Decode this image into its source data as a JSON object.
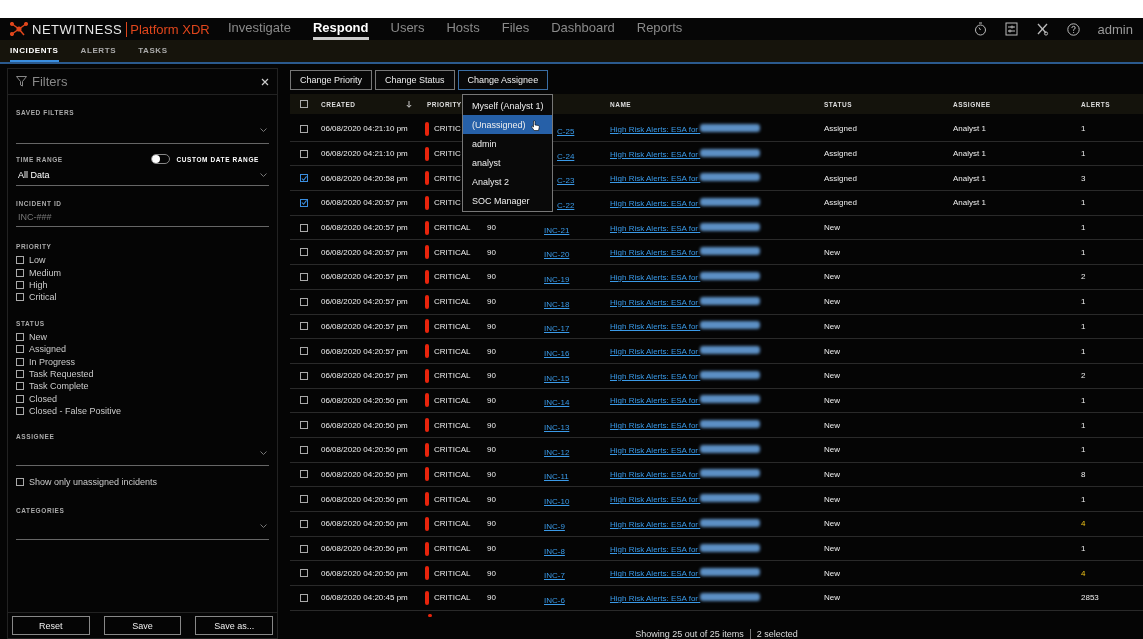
{
  "brand": {
    "name": "NETWITNESS",
    "product": "Platform XDR"
  },
  "nav": [
    {
      "label": "Investigate",
      "selected": false
    },
    {
      "label": "Respond",
      "selected": true
    },
    {
      "label": "Users",
      "selected": false
    },
    {
      "label": "Hosts",
      "selected": false
    },
    {
      "label": "Files",
      "selected": false
    },
    {
      "label": "Dashboard",
      "selected": false
    },
    {
      "label": "Reports",
      "selected": false
    }
  ],
  "user": "admin",
  "subtabs": [
    {
      "label": "INCIDENTS",
      "selected": true
    },
    {
      "label": "ALERTS",
      "selected": false
    },
    {
      "label": "TASKS",
      "selected": false
    }
  ],
  "filters": {
    "title": "Filters",
    "saved_filters_label": "SAVED FILTERS",
    "time_range_label": "TIME RANGE",
    "custom_range": {
      "label": "CUSTOM DATE RANGE",
      "on": false
    },
    "time_range_value": "All Data",
    "incident_id_label": "INCIDENT ID",
    "incident_id_placeholder": "INC-###",
    "priority_label": "PRIORITY",
    "priority": [
      {
        "label": "Low",
        "checked": false
      },
      {
        "label": "Medium",
        "checked": false
      },
      {
        "label": "High",
        "checked": false
      },
      {
        "label": "Critical",
        "checked": false
      }
    ],
    "status_label": "STATUS",
    "status": [
      {
        "label": "New",
        "checked": false
      },
      {
        "label": "Assigned",
        "checked": false
      },
      {
        "label": "In Progress",
        "checked": false
      },
      {
        "label": "Task Requested",
        "checked": false
      },
      {
        "label": "Task Complete",
        "checked": false
      },
      {
        "label": "Closed",
        "checked": false
      },
      {
        "label": "Closed - False Positive",
        "checked": false
      }
    ],
    "assignee_label": "ASSIGNEE",
    "unassigned_only": {
      "label": "Show only unassigned incidents",
      "checked": false
    },
    "categories_label": "CATEGORIES",
    "buttons": [
      "Reset",
      "Save",
      "Save as..."
    ]
  },
  "actions": [
    "Change Priority",
    "Change Status",
    "Change Assignee"
  ],
  "assignee_menu": [
    {
      "label": "Myself (Analyst 1)",
      "selected": false
    },
    {
      "label": "(Unassigned)",
      "selected": true
    },
    {
      "label": "admin",
      "selected": false
    },
    {
      "label": "analyst",
      "selected": false
    },
    {
      "label": "Analyst 2",
      "selected": false
    },
    {
      "label": "SOC Manager",
      "selected": false
    }
  ],
  "columns": {
    "created": "CREATED",
    "priority": "PRIORITY",
    "name": "NAME",
    "status": "STATUS",
    "assignee": "ASSIGNEE",
    "alerts": "ALERTS"
  },
  "header_checked": false,
  "rows": [
    {
      "checked": false,
      "created": "06/08/2020 04:21:10 pm",
      "priority": "CRITIC",
      "score": "",
      "id": "C-25",
      "name": "High Risk Alerts: ESA for",
      "status": "Assigned",
      "assignee": "Analyst 1",
      "alerts": "1",
      "flagged": false
    },
    {
      "checked": false,
      "created": "06/08/2020 04:21:10 pm",
      "priority": "CRITIC",
      "score": "",
      "id": "C-24",
      "name": "High Risk Alerts: ESA for",
      "status": "Assigned",
      "assignee": "Analyst 1",
      "alerts": "1",
      "flagged": false
    },
    {
      "checked": true,
      "created": "06/08/2020 04:20:58 pm",
      "priority": "CRITIC",
      "score": "",
      "id": "C-23",
      "name": "High Risk Alerts: ESA for",
      "status": "Assigned",
      "assignee": "Analyst 1",
      "alerts": "3",
      "flagged": false
    },
    {
      "checked": true,
      "created": "06/08/2020 04:20:57 pm",
      "priority": "CRITIC",
      "score": "",
      "id": "C-22",
      "name": "High Risk Alerts: ESA for",
      "status": "Assigned",
      "assignee": "Analyst 1",
      "alerts": "1",
      "flagged": false
    },
    {
      "checked": false,
      "created": "06/08/2020 04:20:57 pm",
      "priority": "CRITICAL",
      "score": "90",
      "id": "INC-21",
      "name": "High Risk Alerts: ESA for",
      "status": "New",
      "assignee": "",
      "alerts": "1",
      "flagged": false
    },
    {
      "checked": false,
      "created": "06/08/2020 04:20:57 pm",
      "priority": "CRITICAL",
      "score": "90",
      "id": "INC-20",
      "name": "High Risk Alerts: ESA for",
      "status": "New",
      "assignee": "",
      "alerts": "1",
      "flagged": false
    },
    {
      "checked": false,
      "created": "06/08/2020 04:20:57 pm",
      "priority": "CRITICAL",
      "score": "90",
      "id": "INC-19",
      "name": "High Risk Alerts: ESA for",
      "status": "New",
      "assignee": "",
      "alerts": "2",
      "flagged": false
    },
    {
      "checked": false,
      "created": "06/08/2020 04:20:57 pm",
      "priority": "CRITICAL",
      "score": "90",
      "id": "INC-18",
      "name": "High Risk Alerts: ESA for",
      "status": "New",
      "assignee": "",
      "alerts": "1",
      "flagged": false
    },
    {
      "checked": false,
      "created": "06/08/2020 04:20:57 pm",
      "priority": "CRITICAL",
      "score": "90",
      "id": "INC-17",
      "name": "High Risk Alerts: ESA for",
      "status": "New",
      "assignee": "",
      "alerts": "1",
      "flagged": false
    },
    {
      "checked": false,
      "created": "06/08/2020 04:20:57 pm",
      "priority": "CRITICAL",
      "score": "90",
      "id": "INC-16",
      "name": "High Risk Alerts: ESA for",
      "status": "New",
      "assignee": "",
      "alerts": "1",
      "flagged": false
    },
    {
      "checked": false,
      "created": "06/08/2020 04:20:57 pm",
      "priority": "CRITICAL",
      "score": "90",
      "id": "INC-15",
      "name": "High Risk Alerts: ESA for",
      "status": "New",
      "assignee": "",
      "alerts": "2",
      "flagged": false
    },
    {
      "checked": false,
      "created": "06/08/2020 04:20:50 pm",
      "priority": "CRITICAL",
      "score": "90",
      "id": "INC-14",
      "name": "High Risk Alerts: ESA for",
      "status": "New",
      "assignee": "",
      "alerts": "1",
      "flagged": false
    },
    {
      "checked": false,
      "created": "06/08/2020 04:20:50 pm",
      "priority": "CRITICAL",
      "score": "90",
      "id": "INC-13",
      "name": "High Risk Alerts: ESA for",
      "status": "New",
      "assignee": "",
      "alerts": "1",
      "flagged": false
    },
    {
      "checked": false,
      "created": "06/08/2020 04:20:50 pm",
      "priority": "CRITICAL",
      "score": "90",
      "id": "INC-12",
      "name": "High Risk Alerts: ESA for",
      "status": "New",
      "assignee": "",
      "alerts": "1",
      "flagged": false
    },
    {
      "checked": false,
      "created": "06/08/2020 04:20:50 pm",
      "priority": "CRITICAL",
      "score": "90",
      "id": "INC-11",
      "name": "High Risk Alerts: ESA for",
      "status": "New",
      "assignee": "",
      "alerts": "8",
      "flagged": false
    },
    {
      "checked": false,
      "created": "06/08/2020 04:20:50 pm",
      "priority": "CRITICAL",
      "score": "90",
      "id": "INC-10",
      "name": "High Risk Alerts: ESA for",
      "status": "New",
      "assignee": "",
      "alerts": "1",
      "flagged": false
    },
    {
      "checked": false,
      "created": "06/08/2020 04:20:50 pm",
      "priority": "CRITICAL",
      "score": "90",
      "id": "INC-9",
      "name": "High Risk Alerts: ESA for",
      "status": "New",
      "assignee": "",
      "alerts": "4",
      "flagged": true
    },
    {
      "checked": false,
      "created": "06/08/2020 04:20:50 pm",
      "priority": "CRITICAL",
      "score": "90",
      "id": "INC-8",
      "name": "High Risk Alerts: ESA for",
      "status": "New",
      "assignee": "",
      "alerts": "1",
      "flagged": false
    },
    {
      "checked": false,
      "created": "06/08/2020 04:20:50 pm",
      "priority": "CRITICAL",
      "score": "90",
      "id": "INC-7",
      "name": "High Risk Alerts: ESA for",
      "status": "New",
      "assignee": "",
      "alerts": "4",
      "flagged": true
    },
    {
      "checked": false,
      "created": "06/08/2020 04:20:45 pm",
      "priority": "CRITICAL",
      "score": "90",
      "id": "INC-6",
      "name": "High Risk Alerts: ESA for",
      "status": "New",
      "assignee": "",
      "alerts": "2853",
      "flagged": false
    }
  ],
  "footer": {
    "count": "Showing 25 out of 25 items",
    "selected": "2 selected"
  }
}
